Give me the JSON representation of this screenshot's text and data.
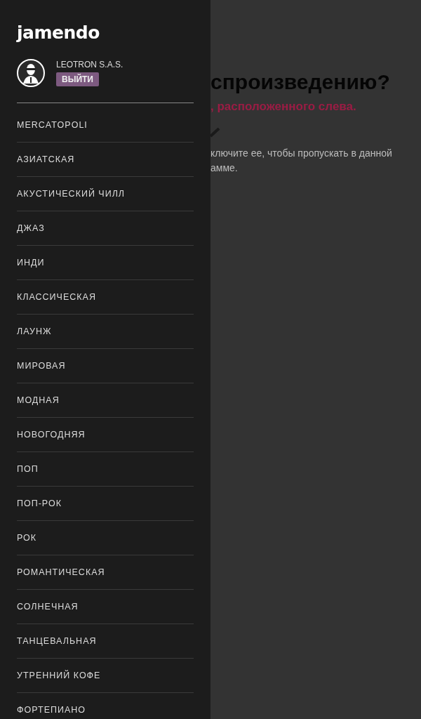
{
  "drawer": {
    "logo": "jamendo",
    "user": {
      "name": "LEOTRON S.A.S.",
      "logout": "ВЫЙТИ"
    },
    "items": [
      "MERCATOPOLI",
      "АЗИАТСКАЯ",
      "АКУСТИЧЕСКИЙ ЧИЛЛ",
      "ДЖАЗ",
      "ИНДИ",
      "КЛАССИЧЕСКАЯ",
      "ЛАУНЖ",
      "МИРОВАЯ",
      "МОДНАЯ",
      "НОВОГОДНЯЯ",
      "ПОП",
      "ПОП-РОК",
      "РОК",
      "РОМАНТИЧЕСКАЯ",
      "СОЛНЕЧНАЯ",
      "ТАНЦЕВАЛЬНАЯ",
      "УТРЕННИЙ КОФЕ",
      "ФОРТЕПИАНО"
    ]
  },
  "page": {
    "heading": "спроизведению?",
    "hint": ", расположенного слева.",
    "text_lines": [
      "ключите ее, чтобы пропускать в данной",
      "амме."
    ]
  }
}
